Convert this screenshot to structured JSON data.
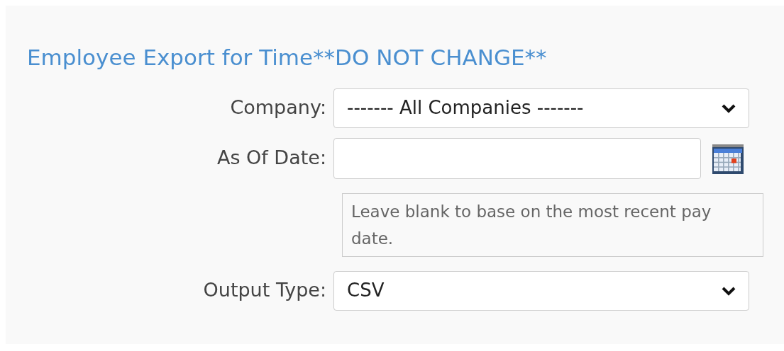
{
  "title": "Employee Export for Time**DO NOT CHANGE**",
  "fields": [
    {
      "kind": "select",
      "label": "Company:",
      "value": "------- All Companies -------"
    },
    {
      "kind": "date",
      "label": "As Of Date:"
    },
    {
      "kind": "note",
      "text": "Leave blank to base on the most recent pay date."
    },
    {
      "kind": "select",
      "label": "Output Type:",
      "value": "CSV"
    }
  ]
}
